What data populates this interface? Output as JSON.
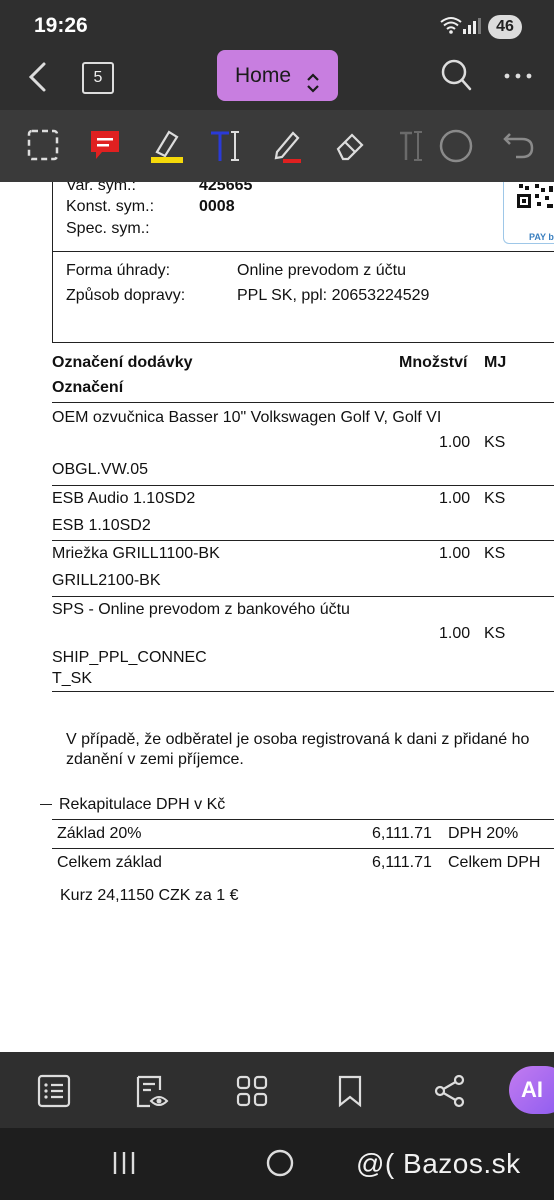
{
  "status_bar": {
    "time": "19:26",
    "battery": "46",
    "icons": [
      "wifi-icon",
      "cell-signal-icon",
      "battery-icon"
    ]
  },
  "nav": {
    "page_count": "5",
    "home_label": "Home",
    "icons": [
      "back-arrow-icon",
      "chevron-updown-icon",
      "search-icon",
      "more-dots-icon"
    ]
  },
  "toolbar": {
    "tools": [
      "select-rect-icon",
      "comment-icon",
      "highlighter-icon",
      "text-edit-icon",
      "pen-icon",
      "eraser-icon",
      "text-cursor-icon",
      "shape-circle-icon",
      "undo-icon"
    ],
    "colors": {
      "comment": "#e02020",
      "highlighter": "#f5d90a",
      "text": "#2a3ad6",
      "pen": "#e02020"
    }
  },
  "document": {
    "payment_block": [
      {
        "label": "Var. sym.:",
        "value": "425665"
      },
      {
        "label": "Konst. sym.:",
        "value": "0008"
      },
      {
        "label": "Spec. sym.:",
        "value": ""
      }
    ],
    "qr_label": "PAY b",
    "delivery_block": [
      {
        "label": "Forma úhrady:",
        "value": "Online prevodom z účtu"
      },
      {
        "label": "Způsob dopravy:",
        "value": "PPL SK, ppl: 20653224529"
      }
    ],
    "items_header": {
      "col1": "Označení dodávky",
      "col1_sub": "Označení",
      "qty": "Množství",
      "unit": "MJ"
    },
    "items": [
      {
        "name": "OEM ozvučnica Basser 10\" Volkswagen Golf V, Golf VI",
        "qty": "1.00",
        "unit": "KS",
        "code": "OBGL.VW.05"
      },
      {
        "name": "ESB Audio 1.10SD2",
        "qty": "1.00",
        "unit": "KS",
        "code": "ESB 1.10SD2"
      },
      {
        "name": "Mriežka GRILL1100-BK",
        "qty": "1.00",
        "unit": "KS",
        "code": "GRILL2100-BK"
      },
      {
        "name": "SPS - Online prevodom z bankového účtu",
        "qty": "1.00",
        "unit": "KS",
        "code": "SHIP_PPL_CONNEC",
        "code_line2": "T_SK"
      }
    ],
    "vat_note_line1": "V případě, že odběratel je osoba registrovaná k dani z přidané ho",
    "vat_note_line2": "zdanění v zemi příjemce.",
    "recap": {
      "title": "Rekapitulace DPH v Kč",
      "rows": [
        {
          "label": "Základ 20%",
          "value": "6,111.71",
          "tax_label": "DPH 20%"
        },
        {
          "label": "Celkem základ",
          "value": "6,111.71",
          "tax_label": "Celkem DPH"
        }
      ],
      "rate": "Kurz 24,1150 CZK za 1 €"
    }
  },
  "bottom_bar": {
    "icons": [
      "list-icon",
      "document-view-icon",
      "grid-icon",
      "bookmark-icon",
      "share-icon"
    ],
    "ai_label": "AI"
  },
  "system_nav": {
    "icons": [
      "recents-icon",
      "home-circle-icon",
      "back-chevron-icon"
    ],
    "watermark": "@( Bazos.sk"
  }
}
